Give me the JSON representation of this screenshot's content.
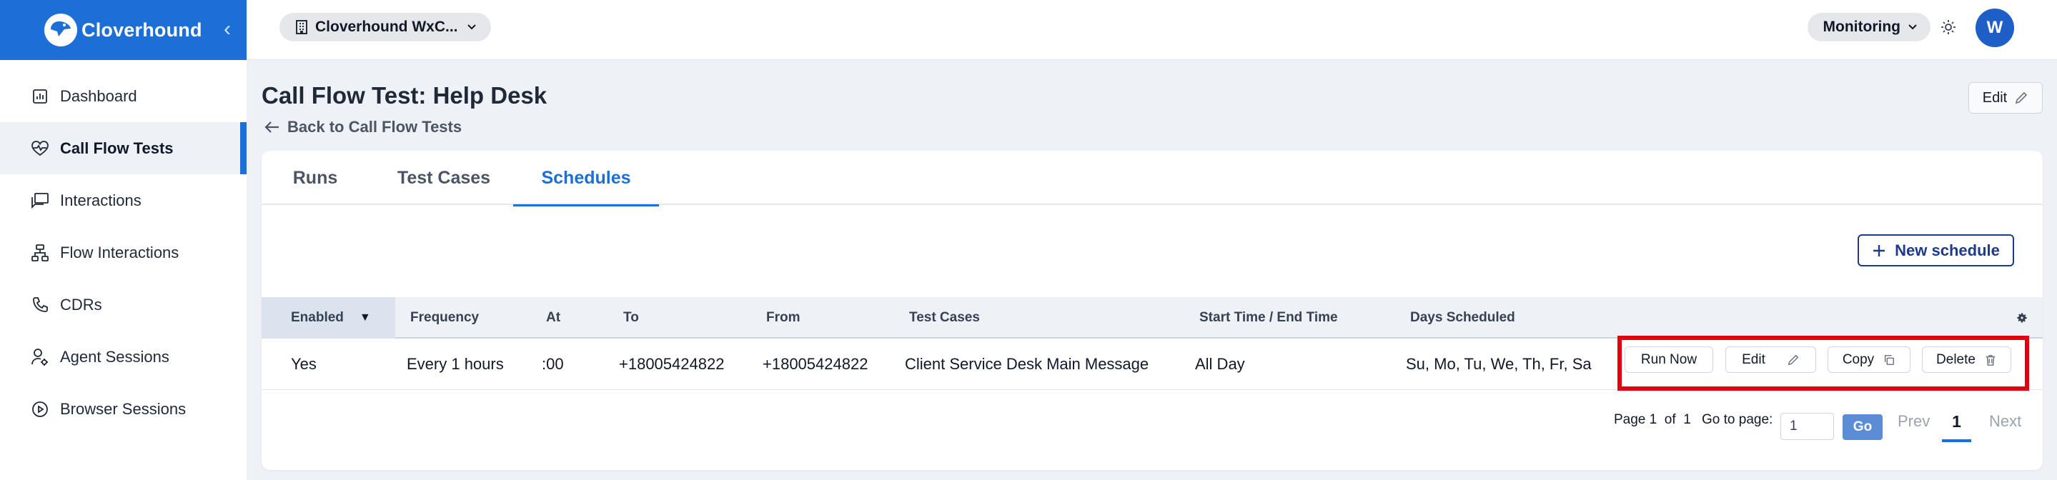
{
  "brand": {
    "name": "Cloverhound"
  },
  "sidebar": {
    "items": [
      {
        "label": "Dashboard",
        "icon": "bar-chart-icon"
      },
      {
        "label": "Call Flow Tests",
        "icon": "heart-pulse-icon",
        "active": true
      },
      {
        "label": "Interactions",
        "icon": "chat-bubbles-icon"
      },
      {
        "label": "Flow Interactions",
        "icon": "flow-chart-icon"
      },
      {
        "label": "CDRs",
        "icon": "phone-icon"
      },
      {
        "label": "Agent Sessions",
        "icon": "user-gear-icon"
      },
      {
        "label": "Browser Sessions",
        "icon": "play-circle-icon"
      }
    ]
  },
  "topbar": {
    "org": "Cloverhound WxC...",
    "mode": "Monitoring",
    "avatar_initial": "W"
  },
  "page": {
    "title": "Call Flow Test: Help Desk",
    "back_label": "Back to Call Flow Tests",
    "edit_label": "Edit"
  },
  "tabs": [
    {
      "label": "Runs"
    },
    {
      "label": "Test Cases"
    },
    {
      "label": "Schedules",
      "active": true
    }
  ],
  "new_schedule_label": "New schedule",
  "table": {
    "columns": [
      "Enabled",
      "Frequency",
      "At",
      "To",
      "From",
      "Test Cases",
      "Start Time / End Time",
      "Days Scheduled"
    ],
    "sort_indicator": "▼",
    "rows": [
      {
        "enabled": "Yes",
        "frequency": "Every 1 hours",
        "at": ":00",
        "to": "+18005424822",
        "from": "+18005424822",
        "test_cases": "Client Service Desk Main Message",
        "time": "All Day",
        "days": "Su, Mo, Tu, We, Th, Fr, Sa"
      }
    ],
    "actions": {
      "run_now": "Run Now",
      "edit": "Edit",
      "copy": "Copy",
      "delete": "Delete"
    }
  },
  "pagination": {
    "page_label": "Page",
    "page": "1",
    "of_label": "of",
    "total": "1",
    "goto_label": "Go to page:",
    "goto_value": "1",
    "go_label": "Go",
    "prev": "Prev",
    "current": "1",
    "next": "Next"
  },
  "colors": {
    "accent": "#1d6fd8",
    "highlight": "#e3000f"
  }
}
